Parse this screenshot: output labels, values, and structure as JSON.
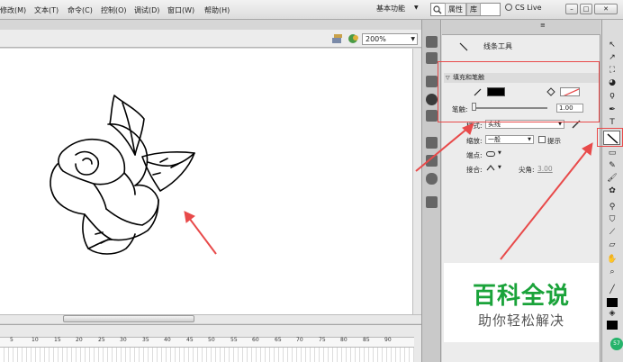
{
  "menubar": {
    "items": [
      "修改(M)",
      "文本(T)",
      "命令(C)",
      "控制(O)",
      "调试(D)",
      "窗口(W)",
      "帮助(H)"
    ],
    "workspace": "基本功能",
    "cslive": "CS Live"
  },
  "stage": {
    "zoom": "200%"
  },
  "timeline": {
    "ticks": [
      "5",
      "10",
      "15",
      "20",
      "25",
      "30",
      "35",
      "40",
      "45",
      "50",
      "55",
      "60",
      "65",
      "70",
      "75",
      "80",
      "85",
      "90"
    ]
  },
  "properties": {
    "tabs": [
      "属性",
      "库"
    ],
    "tool_name": "线条工具",
    "section": "填充和笔触",
    "stroke_label": "笔触:",
    "stroke_value": "1.00",
    "style_label": "样式:",
    "style_value": "实线",
    "scale_label": "缩放:",
    "scale_value": "一般",
    "hint_label": "提示",
    "cap_label": "端点:",
    "join_label": "接合:",
    "miter_label": "尖角:",
    "miter_value": "3.00"
  },
  "promo": {
    "title": "百科全说",
    "subtitle": "助你轻松解决"
  },
  "badge": "57",
  "colors": {
    "highlight": "#e84a4a",
    "promo_green": "#1aa33a"
  }
}
